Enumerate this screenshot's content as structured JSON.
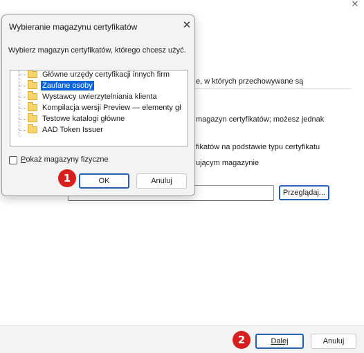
{
  "wizard": {
    "close_glyph": "✕",
    "text_stores": "e, w których przechowywane są",
    "text_auto_1": "magazyn certyfikatów; możesz jednak",
    "text_auto_2": "fikatów na podstawie typu certyfikatu",
    "text_place": "ującym magazynie",
    "browse_label": "Przeglądaj...",
    "next_label": "Dalej",
    "cancel_label": "Anuluj"
  },
  "dialog": {
    "title": "Wybieranie magazynu certyfikatów",
    "close_glyph": "✕",
    "prompt": "Wybierz magazyn certyfikatów, którego chcesz użyć.",
    "tree_items": [
      {
        "label": "Główne urzędy certyfikacji innych firm",
        "selected": false
      },
      {
        "label": "Zaufane osoby",
        "selected": true
      },
      {
        "label": "Wystawcy uwierzytelniania klienta",
        "selected": false
      },
      {
        "label": "Kompilacja wersji Preview — elementy gł",
        "selected": false
      },
      {
        "label": "Testowe katalogi główne",
        "selected": false
      },
      {
        "label": "AAD Token Issuer",
        "selected": false
      }
    ],
    "show_physical_label": "Pokaż magazyny fizyczne",
    "show_physical_checked": false,
    "ok_label": "OK",
    "cancel_label": "Anuluj"
  },
  "annotations": {
    "badge_1": "1",
    "badge_2": "2"
  },
  "colors": {
    "selection": "#0a64d8",
    "badge": "#d81f1f",
    "default_button_border": "#1f5fb4",
    "folder": "#f6d36d"
  }
}
